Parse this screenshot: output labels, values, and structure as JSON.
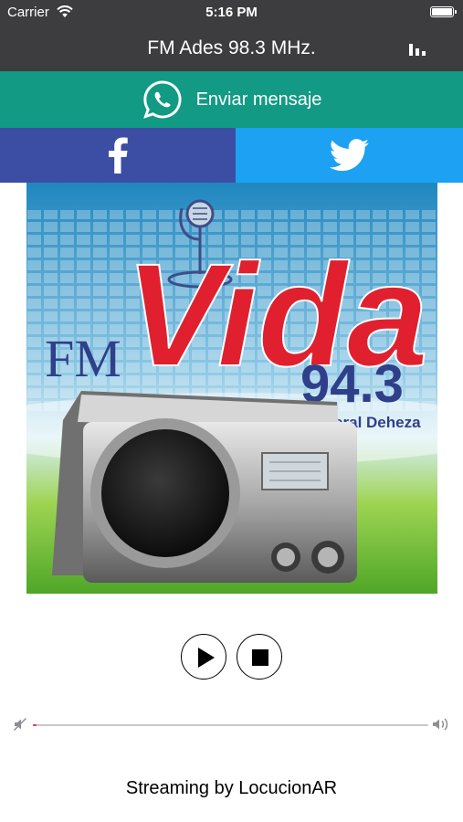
{
  "status_bar": {
    "carrier": "Carrier",
    "time": "5:16 PM"
  },
  "nav": {
    "title": "FM Ades 98.3 MHz."
  },
  "whatsapp": {
    "label": "Enviar mensaje"
  },
  "social": {
    "facebook": "facebook-icon",
    "twitter": "twitter-icon"
  },
  "station_logo": {
    "prefix": "FM",
    "name": "Vida",
    "frequency": "94.3",
    "location": "General Deheza"
  },
  "player": {
    "volume_level": 0.01
  },
  "footer": {
    "text": "Streaming by LocucionAR"
  },
  "colors": {
    "bar": "#3d3d3f",
    "whatsapp": "#129a85",
    "facebook": "#3b4ea3",
    "twitter": "#1da1f2",
    "accent": "#e0384a"
  }
}
